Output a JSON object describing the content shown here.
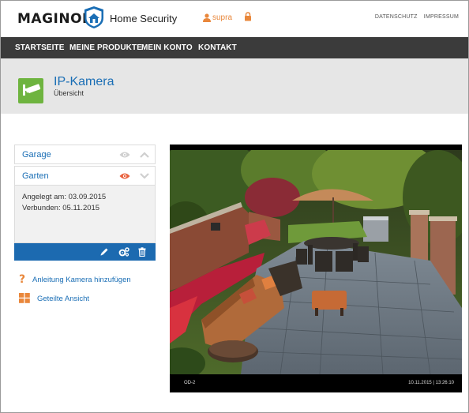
{
  "brand": {
    "logo": "MAGINON",
    "product": "Home Security"
  },
  "user": {
    "name": "supra",
    "icon": "user-icon"
  },
  "toplinks": [
    "DATENSCHUTZ",
    "IMPRESSUM"
  ],
  "nav": [
    "STARTSEITE",
    "MEINE PRODUKTE",
    "MEIN KONTO",
    "KONTAKT"
  ],
  "header": {
    "title": "IP-Kamera",
    "subtitle": "Übersicht"
  },
  "cameras": [
    {
      "name": "Garage",
      "visible": false
    },
    {
      "name": "Garten",
      "visible": true
    }
  ],
  "details": {
    "created": "Angelegt am: 03.09.2015",
    "connected": "Verbunden: 05.11.2015"
  },
  "links": {
    "add_camera": "Anleitung Kamera hinzufügen",
    "split_view": "Geteilte Ansicht"
  },
  "video": {
    "camera_id": "OD-2",
    "timestamp": "10.11.2015 | 13:26:10"
  },
  "colors": {
    "accent": "#1a6eb5",
    "nav_bg": "#3b3b3b",
    "toolbar": "#1c6ab0",
    "user": "#e9873b",
    "badge": "#6eb43f"
  }
}
